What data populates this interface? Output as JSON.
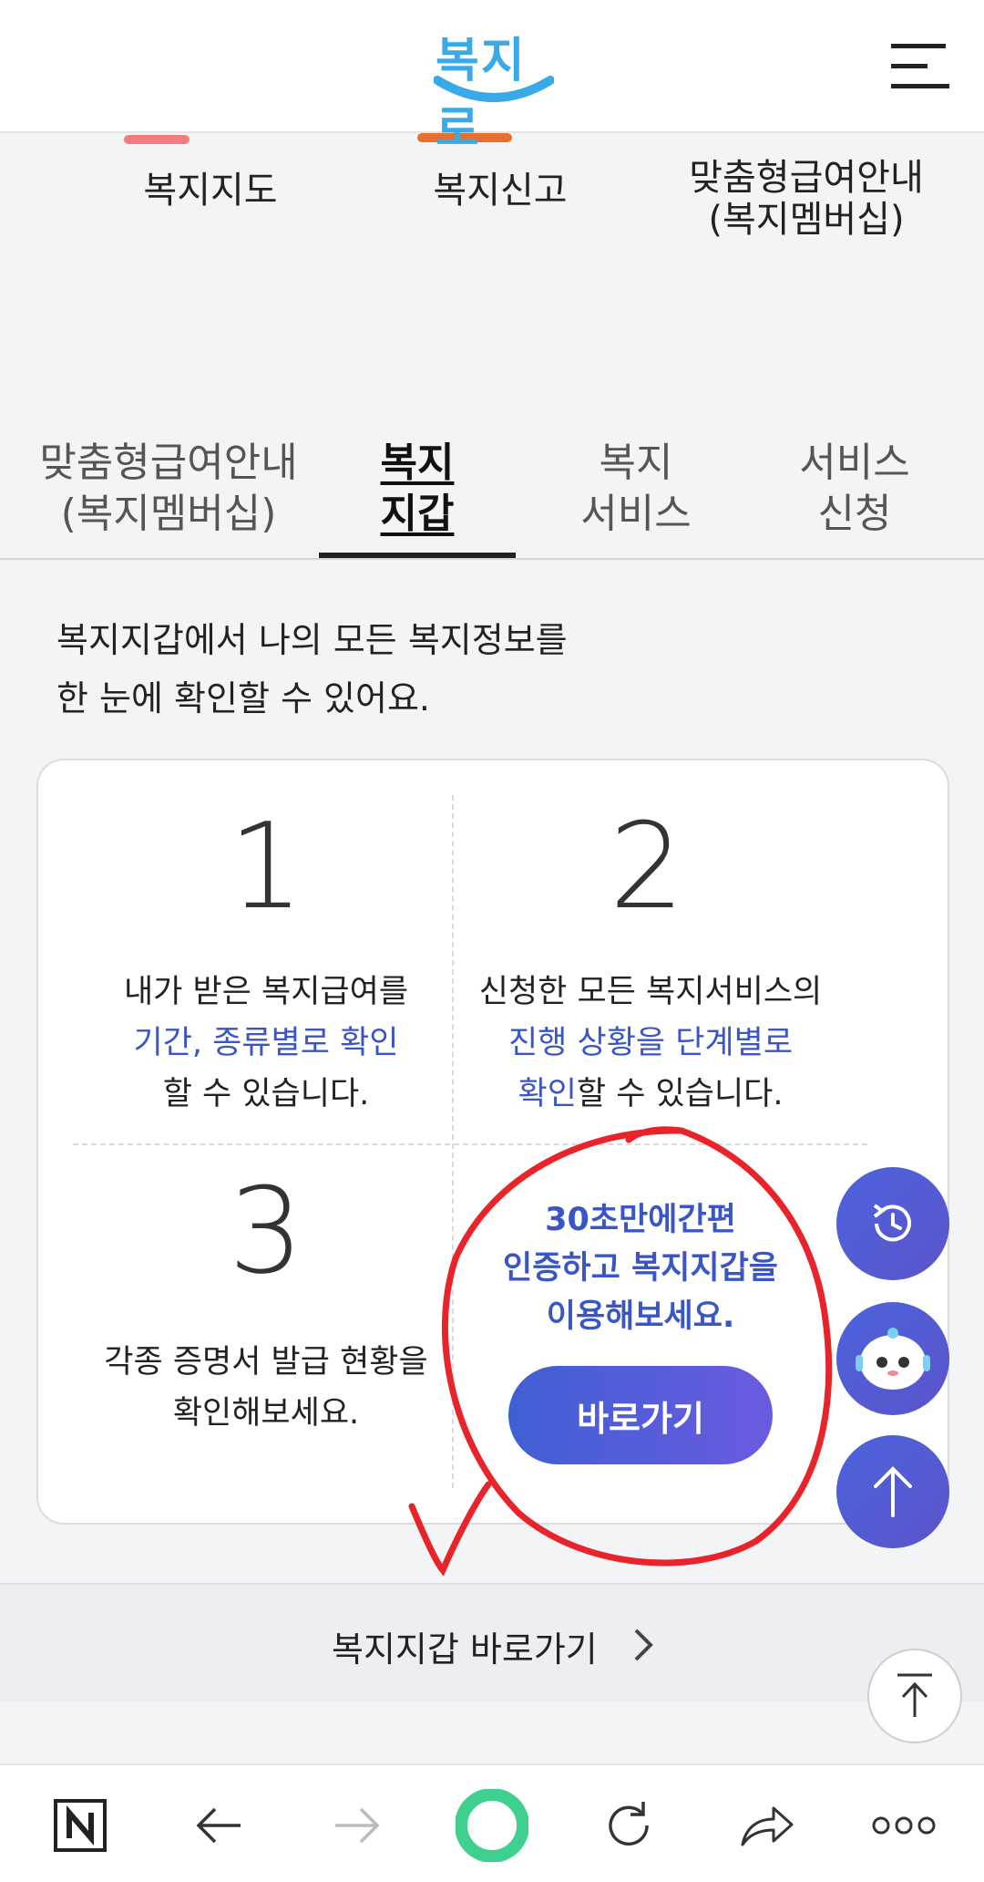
{
  "header": {
    "logo_text": "복지로",
    "menu_icon": "hamburger-menu-icon"
  },
  "quick_menu": {
    "items": [
      {
        "label": "복지지도"
      },
      {
        "label": "복지신고"
      },
      {
        "label_line1": "맞춤형급여안내",
        "label_line2": "(복지멤버십)"
      }
    ]
  },
  "tabs": [
    {
      "line1": "맞춤형급여안내",
      "line2": "(복지멤버십)"
    },
    {
      "line1": "복지",
      "line2": "지갑",
      "active": true
    },
    {
      "line1": "복지",
      "line2": "서비스"
    },
    {
      "line1": "서비스",
      "line2": "신청"
    }
  ],
  "intro": {
    "line1": "복지지갑에서 나의 모든 복지정보를",
    "line2": "한 눈에 확인할 수 있어요."
  },
  "features": [
    {
      "number": "1",
      "line1": "내가 받은 복지급여를",
      "highlight": "기간, 종류별로 확인",
      "line3": "할 수 있습니다."
    },
    {
      "number": "2",
      "line1": "신청한 모든 복지서비스의",
      "highlight": "진행 상황을 단계별로",
      "highlight2": "확인",
      "tail": "할 수 있습니다."
    },
    {
      "number": "3",
      "line1": "각종 증명서 발급 현황을",
      "line2": "확인해보세요."
    }
  ],
  "cta": {
    "line1": "30초만에간편",
    "line2": "인증하고 복지지갑을",
    "line3": "이용해보세요.",
    "button_label": "바로가기"
  },
  "wallet_link": {
    "label": "복지지갑 바로가기"
  },
  "floating_buttons": [
    "recent-history-icon",
    "chatbot-icon",
    "scroll-top-icon"
  ],
  "bottom_nav": [
    "naver-icon",
    "back-icon",
    "forward-icon",
    "home-icon",
    "refresh-icon",
    "share-icon",
    "more-icon"
  ],
  "colors": {
    "accent": "#3a56c6",
    "annotation": "#e8232a",
    "logo": "#3aa9e8"
  }
}
